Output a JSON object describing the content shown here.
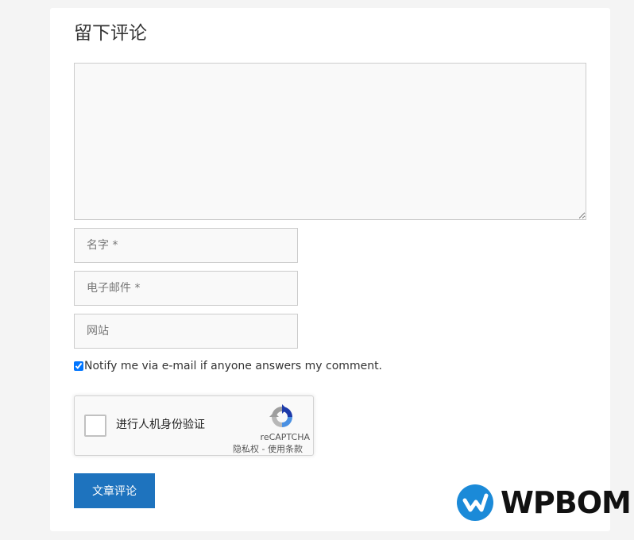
{
  "comment_form": {
    "title": "留下评论",
    "comment_value": "",
    "name_placeholder": "名字 *",
    "email_placeholder": "电子邮件 *",
    "website_placeholder": "网站",
    "notify_label": "Notify me via e-mail if anyone answers my comment.",
    "notify_checked": true,
    "submit_label": "文章评论"
  },
  "recaptcha": {
    "label": "进行人机身份验证",
    "brand": "reCAPTCHA",
    "privacy_link": "隐私权",
    "separator": " - ",
    "terms_link": "使用条款",
    "logo_icon": "recaptcha-logo-icon"
  },
  "watermark": {
    "text": "WPBOM",
    "icon": "wpbom-logo-icon",
    "brand_color": "#1b8ad8"
  },
  "colors": {
    "accent": "#1e73be",
    "page_bg": "#f4f4f4",
    "field_bg": "#f9f9f9"
  }
}
